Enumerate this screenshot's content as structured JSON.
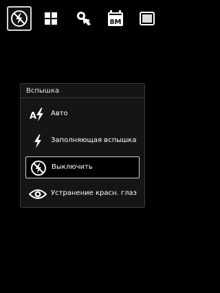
{
  "toolbar": {
    "items": [
      {
        "icon": "flash-off-icon",
        "selected": true
      },
      {
        "icon": "scene-mode-icon",
        "selected": false
      },
      {
        "icon": "white-balance-icon",
        "selected": false
      },
      {
        "icon": "resolution-icon",
        "label": "8M",
        "selected": false
      },
      {
        "icon": "more-settings-icon",
        "selected": false
      }
    ]
  },
  "flash_menu": {
    "title": "Вспышка",
    "options": [
      {
        "icon": "flash-auto-icon",
        "label": "Авто",
        "selected": false
      },
      {
        "icon": "flash-fill-icon",
        "label": "Заполняющая вспышка",
        "selected": false
      },
      {
        "icon": "flash-off-icon",
        "label": "Выключить",
        "selected": true
      },
      {
        "icon": "red-eye-icon",
        "label": "Устранение красн. глаз",
        "selected": false
      }
    ]
  },
  "colors": {
    "background": "#000000",
    "panel": "#151515",
    "selection_border": "#cfcfcf"
  }
}
